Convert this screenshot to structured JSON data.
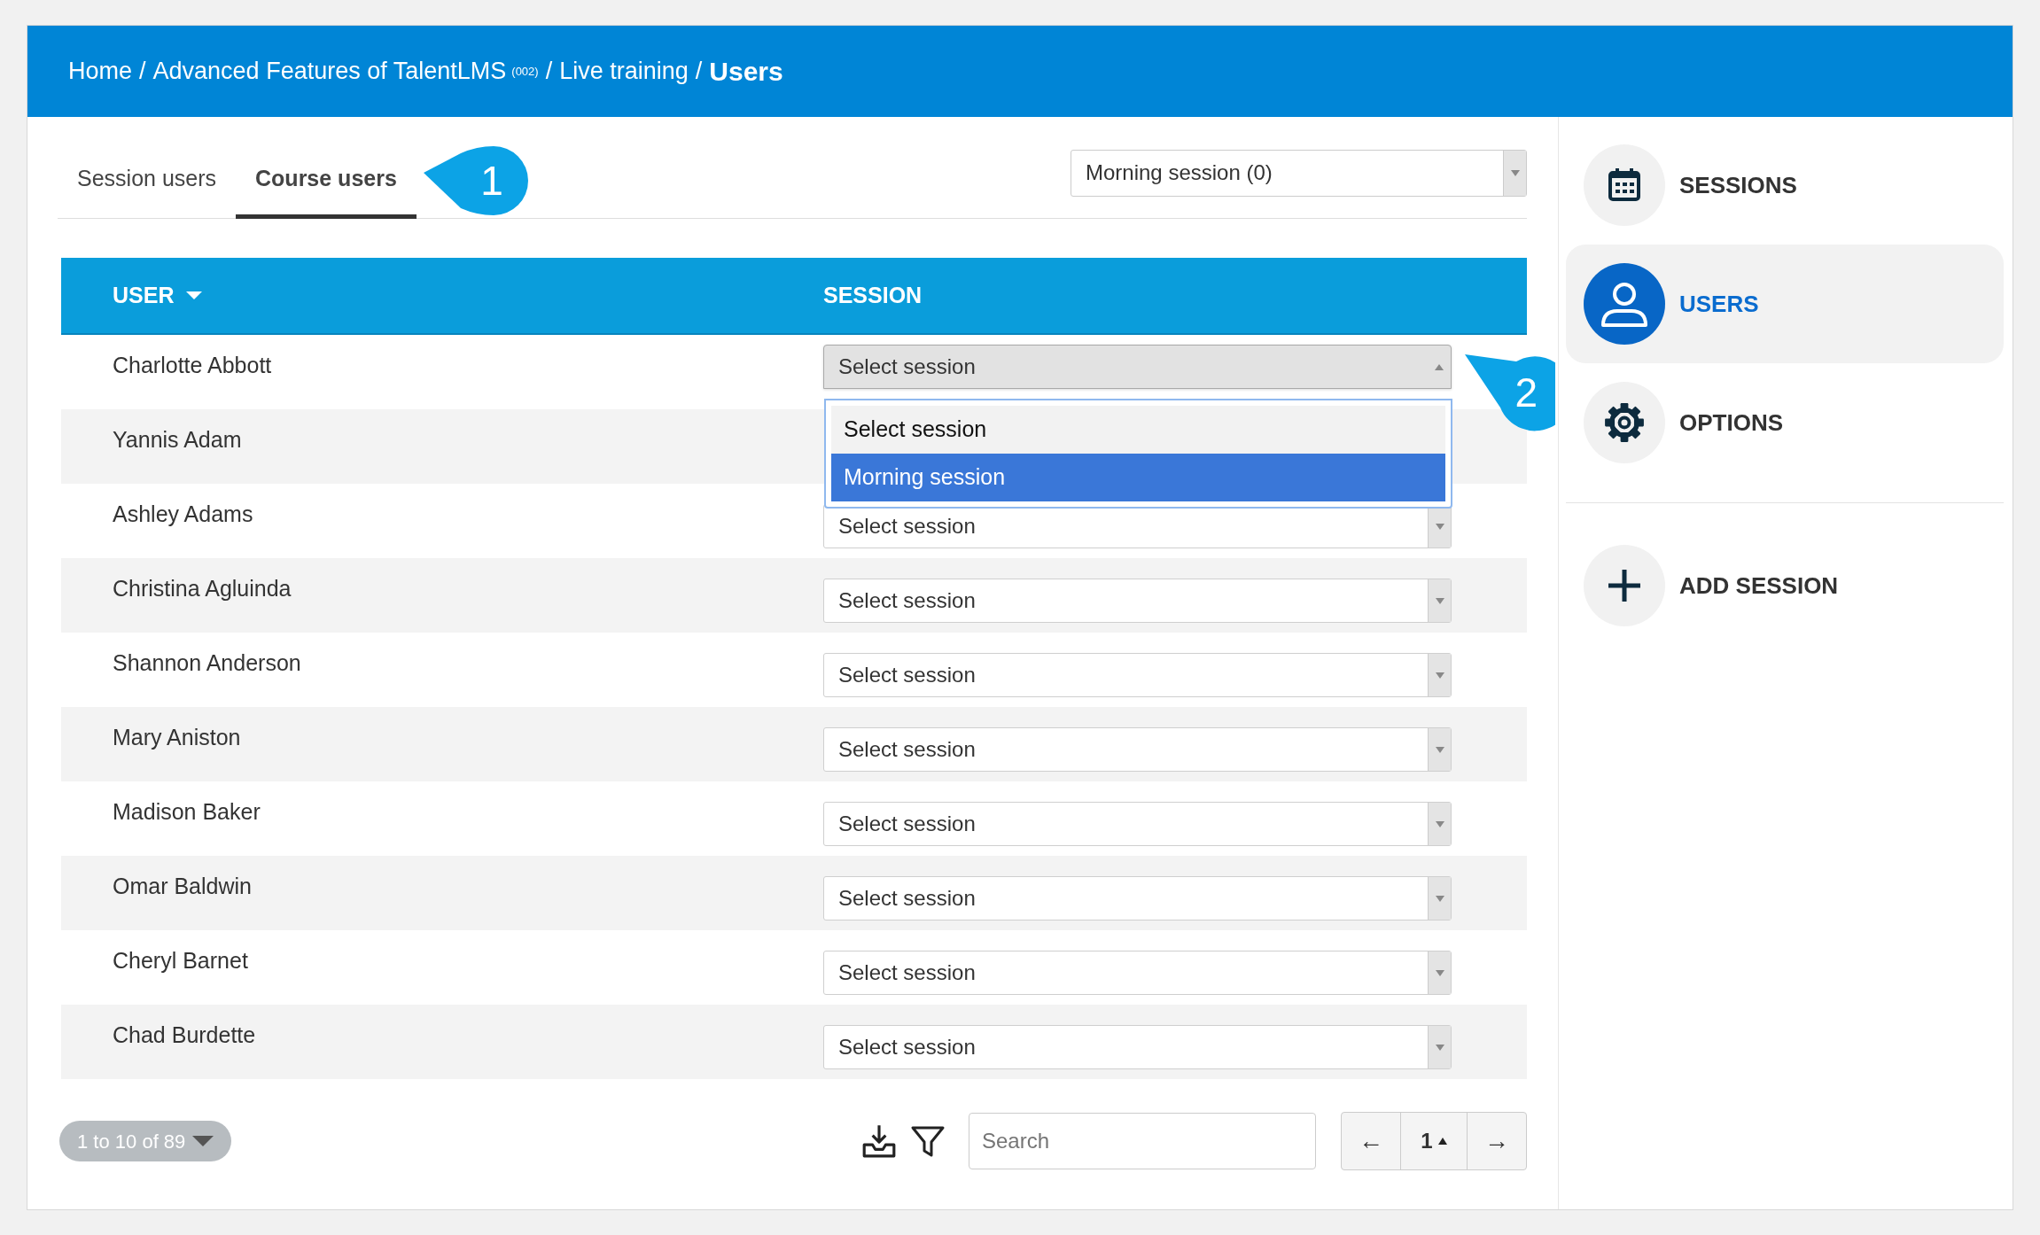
{
  "breadcrumb": {
    "separator": "/",
    "items": [
      {
        "label": "Home",
        "current": false
      },
      {
        "label": "Advanced Features of TalentLMS",
        "note": "(002)",
        "current": false
      },
      {
        "label": "Live training",
        "current": false
      },
      {
        "label": "Users",
        "current": true
      }
    ]
  },
  "tabs": [
    {
      "label": "Session users",
      "selected": false
    },
    {
      "label": "Course users",
      "selected": true
    }
  ],
  "callouts": [
    {
      "label": "1"
    },
    {
      "label": "2"
    }
  ],
  "session_filter": {
    "value": "Morning session (0)"
  },
  "table": {
    "columns": [
      {
        "label": "USER",
        "sorted": true
      },
      {
        "label": "SESSION"
      }
    ],
    "rows": [
      {
        "user": "Charlotte Abbott",
        "session": "Select session",
        "open": true
      },
      {
        "user": "Yannis Adam"
      },
      {
        "user": "Ashley Adams",
        "session": "Select session",
        "open": false
      },
      {
        "user": "Christina Agluinda",
        "session": "Select session",
        "open": false
      },
      {
        "user": "Shannon Anderson",
        "session": "Select session",
        "open": false
      },
      {
        "user": "Mary Aniston",
        "session": "Select session",
        "open": false
      },
      {
        "user": "Madison Baker",
        "session": "Select session",
        "open": false
      },
      {
        "user": "Omar Baldwin",
        "session": "Select session",
        "open": false
      },
      {
        "user": "Cheryl Barnet",
        "session": "Select session",
        "open": false
      },
      {
        "user": "Chad Burdette",
        "session": "Select session",
        "open": false
      }
    ]
  },
  "dropdown": {
    "options": [
      {
        "label": "Select session",
        "selected": false
      },
      {
        "label": "Morning session",
        "selected": true
      }
    ]
  },
  "pagination": {
    "range": "1 to 10 of 89",
    "search": {
      "placeholder": "Search"
    },
    "prev": "←",
    "page": "1",
    "next": "→"
  },
  "sidebar": {
    "items": [
      {
        "label": "SESSIONS",
        "selected": false
      },
      {
        "label": "USERS",
        "selected": true
      },
      {
        "label": "OPTIONS",
        "selected": false
      }
    ],
    "action": {
      "label": "ADD SESSION"
    }
  }
}
